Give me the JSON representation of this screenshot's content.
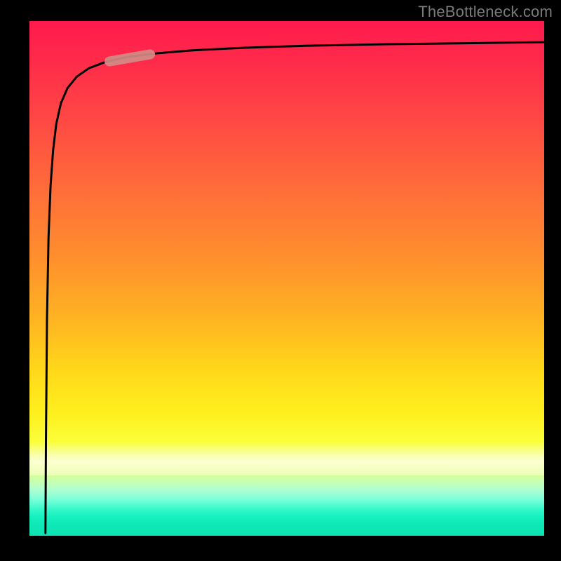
{
  "watermark": "TheBottleneck.com",
  "colors": {
    "background": "#000000",
    "curve": "#000000",
    "highlight_fill": "#d28b85",
    "gradient_top": "#ff1a4d",
    "gradient_mid": "#ffd81a",
    "gradient_bottom": "#0be3b2"
  },
  "chart_data": {
    "type": "line",
    "title": "",
    "xlabel": "",
    "ylabel": "",
    "xlim": [
      0,
      100
    ],
    "ylim": [
      0,
      100
    ],
    "series": [
      {
        "name": "curve",
        "x": [
          3.1,
          3.2,
          3.4,
          3.7,
          4.1,
          4.6,
          5.2,
          6.1,
          7.4,
          9.2,
          11.5,
          14.6,
          18.8,
          24.4,
          31.7,
          41.2,
          53.6,
          69.7,
          85.0,
          100.0
        ],
        "y": [
          0.5,
          18.0,
          42.0,
          58.0,
          68.0,
          75.0,
          80.0,
          84.0,
          87.0,
          89.2,
          90.8,
          92.0,
          93.0,
          93.7,
          94.3,
          94.8,
          95.2,
          95.5,
          95.7,
          95.9
        ]
      }
    ],
    "highlight_segment": {
      "x_start": 14.6,
      "x_end": 24.4,
      "y_start": 92.0,
      "y_end": 93.7
    }
  }
}
